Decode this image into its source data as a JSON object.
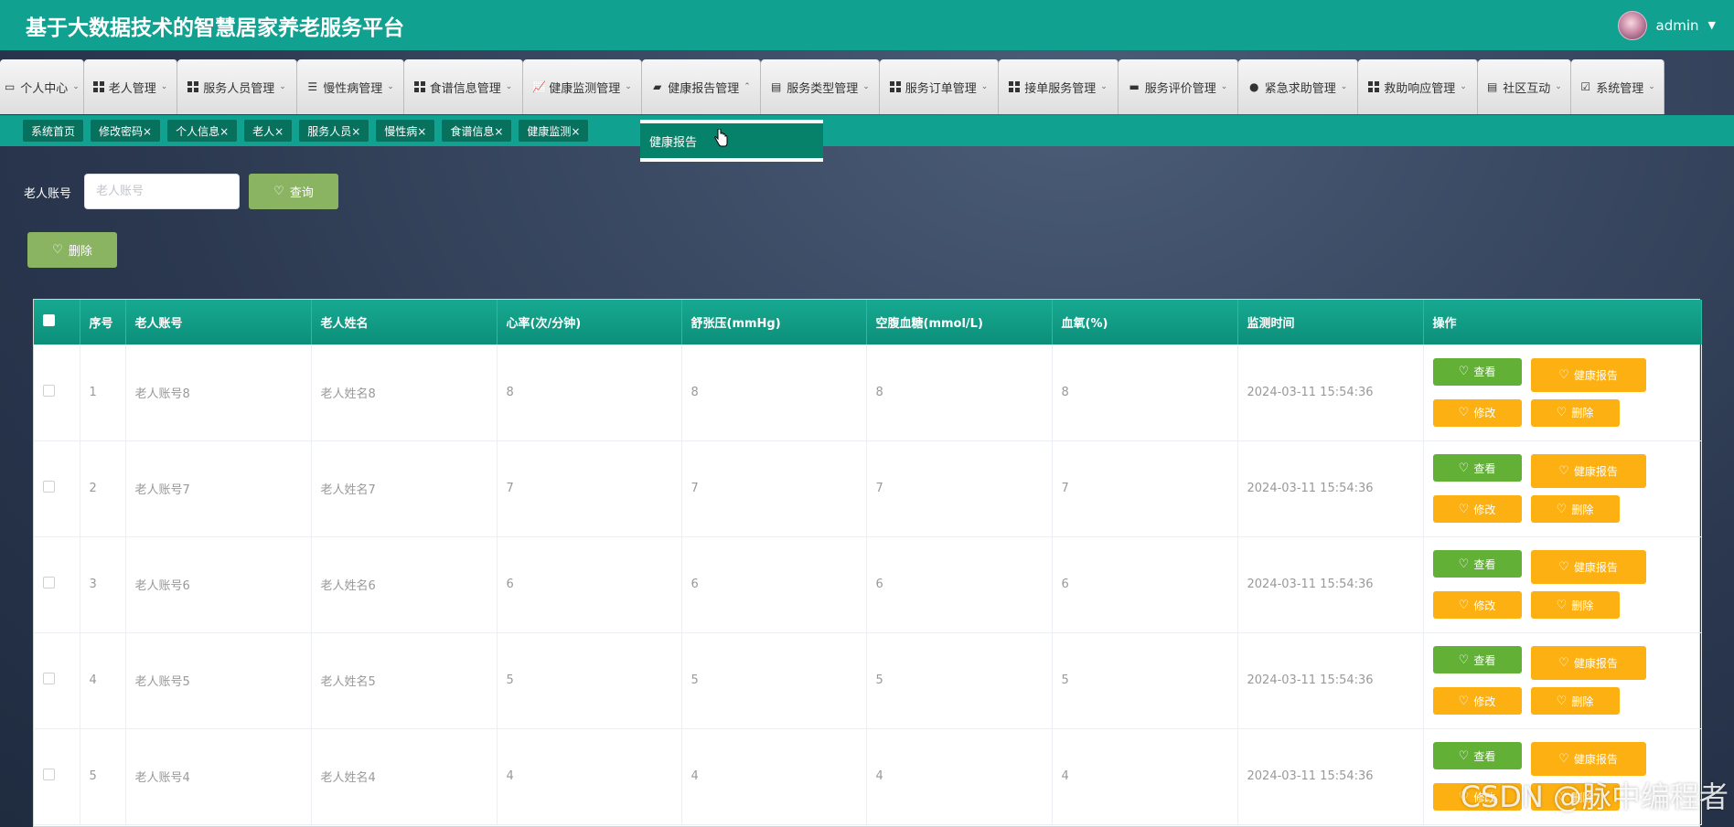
{
  "app": {
    "title": "基于大数据技术的智慧居家养老服务平台",
    "user": "admin"
  },
  "nav": [
    {
      "label": "个人中心",
      "icon": "id-card-icon"
    },
    {
      "label": "老人管理",
      "icon": "grid-icon"
    },
    {
      "label": "服务人员管理",
      "icon": "grid-icon"
    },
    {
      "label": "慢性病管理",
      "icon": "sliders-icon"
    },
    {
      "label": "食谱信息管理",
      "icon": "grid-icon"
    },
    {
      "label": "健康监测管理",
      "icon": "chart-icon"
    },
    {
      "label": "健康报告管理",
      "icon": "wallet-icon"
    },
    {
      "label": "服务类型管理",
      "icon": "clipboard-icon"
    },
    {
      "label": "服务订单管理",
      "icon": "grid-icon"
    },
    {
      "label": "接单服务管理",
      "icon": "grid-icon"
    },
    {
      "label": "服务评价管理",
      "icon": "briefcase-icon"
    },
    {
      "label": "紧急求助管理",
      "icon": "user-icon"
    },
    {
      "label": "救助响应管理",
      "icon": "grid-icon"
    },
    {
      "label": "社区互动",
      "icon": "clipboard-icon"
    },
    {
      "label": "系统管理",
      "icon": "clipboard-check-icon"
    }
  ],
  "tabs": [
    "系统首页",
    "修改密码×",
    "个人信息×",
    "老人×",
    "服务人员×",
    "慢性病×",
    "食谱信息×",
    "健康监测×"
  ],
  "dropdown": {
    "item": "健康报告"
  },
  "search": {
    "label": "老人账号",
    "placeholder": "老人账号",
    "value": "",
    "button": "查询"
  },
  "toolbar": {
    "delete": "删除"
  },
  "table": {
    "headers": [
      "序号",
      "老人账号",
      "老人姓名",
      "心率(次/分钟)",
      "舒张压(mmHg)",
      "空腹血糖(mmol/L)",
      "血氧(%)",
      "监测时间",
      "操作"
    ],
    "rows": [
      {
        "no": "1",
        "account": "老人账号8",
        "name": "老人姓名8",
        "hr": "8",
        "dbp": "8",
        "glucose": "8",
        "spo2": "8",
        "time": "2024-03-11 15:54:36"
      },
      {
        "no": "2",
        "account": "老人账号7",
        "name": "老人姓名7",
        "hr": "7",
        "dbp": "7",
        "glucose": "7",
        "spo2": "7",
        "time": "2024-03-11 15:54:36"
      },
      {
        "no": "3",
        "account": "老人账号6",
        "name": "老人姓名6",
        "hr": "6",
        "dbp": "6",
        "glucose": "6",
        "spo2": "6",
        "time": "2024-03-11 15:54:36"
      },
      {
        "no": "4",
        "account": "老人账号5",
        "name": "老人姓名5",
        "hr": "5",
        "dbp": "5",
        "glucose": "5",
        "spo2": "5",
        "time": "2024-03-11 15:54:36"
      },
      {
        "no": "5",
        "account": "老人账号4",
        "name": "老人姓名4",
        "hr": "4",
        "dbp": "4",
        "glucose": "4",
        "spo2": "4",
        "time": "2024-03-11 15:54:36"
      }
    ],
    "actions": {
      "view": "查看",
      "report": "健康报告",
      "edit": "修改",
      "delete": "删除"
    }
  },
  "watermark": "CSDN @脉中编程者",
  "colors": {
    "header": "#10a191",
    "tab": "#07715e",
    "view": "#62b036",
    "action": "#fdb011",
    "query": "#8ab462"
  }
}
